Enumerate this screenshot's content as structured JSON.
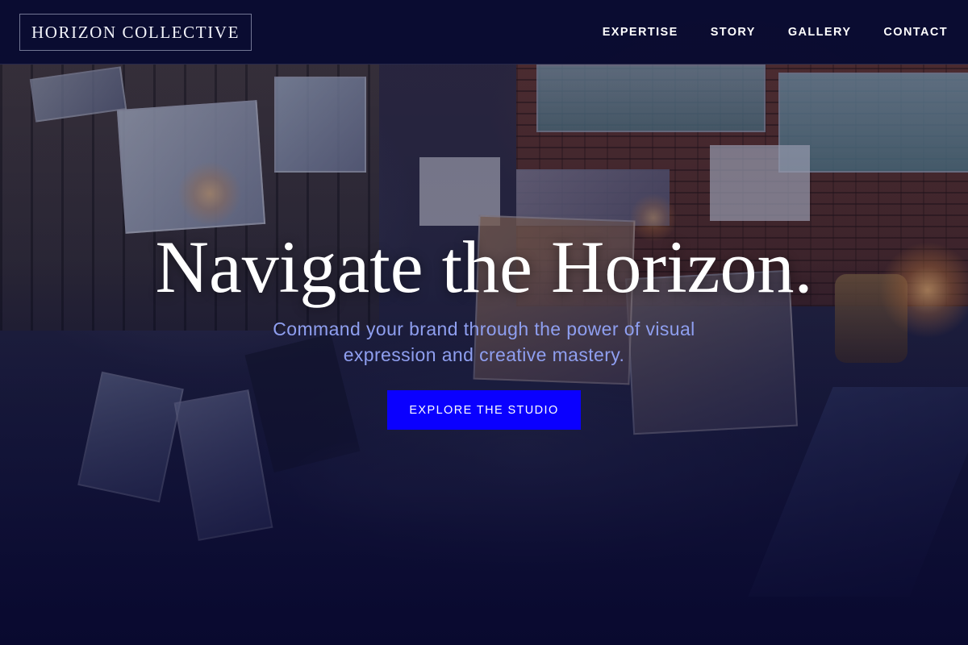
{
  "header": {
    "logo_text": "HORIZON COLLECTIVE",
    "nav": [
      {
        "label": "EXPERTISE"
      },
      {
        "label": "STORY"
      },
      {
        "label": "GALLERY"
      },
      {
        "label": "CONTACT"
      }
    ]
  },
  "hero": {
    "title": "Navigate the Horizon.",
    "subtitle": "Command your brand through the power of visual expression and creative mastery.",
    "cta_label": "EXPLORE THE STUDIO",
    "background_image": "art-studio-photo"
  },
  "colors": {
    "header_bg": "#080a30",
    "cta_bg": "#0a00ff",
    "subtitle": "#8f9ff0",
    "overlay": "#0c0e34"
  }
}
